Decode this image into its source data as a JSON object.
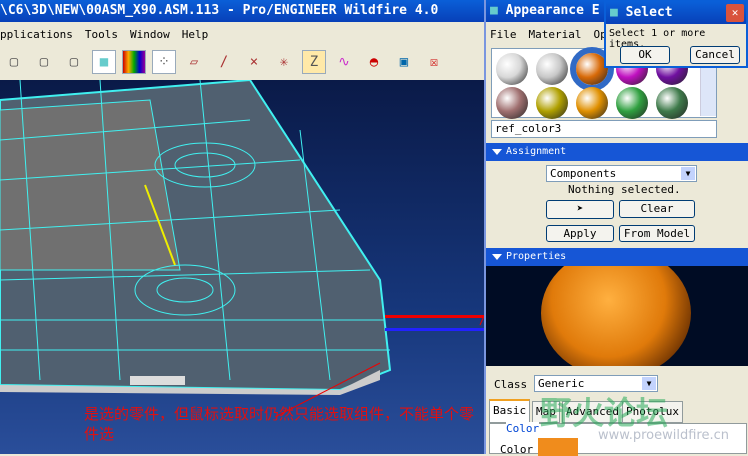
{
  "main": {
    "title": "\\C6\\3D\\NEW\\00ASM_X90.ASM.113 - Pro/ENGINEER Wildfire 4.0",
    "menu": [
      "pplications",
      "Tools",
      "Window",
      "Help"
    ],
    "toolbar": [
      "wireframe-icon",
      "hidden-line-icon",
      "no-hidden-icon",
      "shading-icon",
      "color-bands-icon",
      "model-tree-icon",
      "datum-plane-icon",
      "datum-axis-icon",
      "datum-point-icon",
      "coord-sys-icon",
      "annotation-icon",
      "spin-center-icon",
      "surface-analysis-icon",
      "window-activate-icon",
      "close-window-icon"
    ]
  },
  "annotation": {
    "text": "是选的零件，但鼠标选取时仍然只能选取组件，不能单个零件选",
    "color": "#e01010"
  },
  "appearance": {
    "title": "Appearance E",
    "menu": [
      "File",
      "Material",
      "Opt"
    ],
    "swatches": [
      "#d8d8d8",
      "#c8c8c8",
      "#d86a08",
      "#c010c0",
      "#7010a0",
      "#a07070",
      "#b0a000",
      "#e09000",
      "#30a040",
      "#3e7a4a"
    ],
    "selected_swatch": 2,
    "name": "ref_color3",
    "assignment": {
      "header": "Assignment",
      "filter": "Components",
      "status": "Nothing selected.",
      "clear": "Clear",
      "apply": "Apply",
      "from_model": "From Model"
    },
    "properties": {
      "header": "Properties",
      "class_label": "Class",
      "class_value": "Generic",
      "tabs": [
        "Basic",
        "Map",
        "Advanced",
        "Photolux"
      ],
      "active_tab": "Basic",
      "group": "Color",
      "color_label": "Color",
      "color": "#f08c1c"
    }
  },
  "select_dialog": {
    "title": "Select",
    "message": "Select 1 or more items.",
    "ok": "OK",
    "cancel": "Cancel"
  },
  "watermark": {
    "logo": "野火论坛",
    "url": "www.proewildfire.cn"
  }
}
